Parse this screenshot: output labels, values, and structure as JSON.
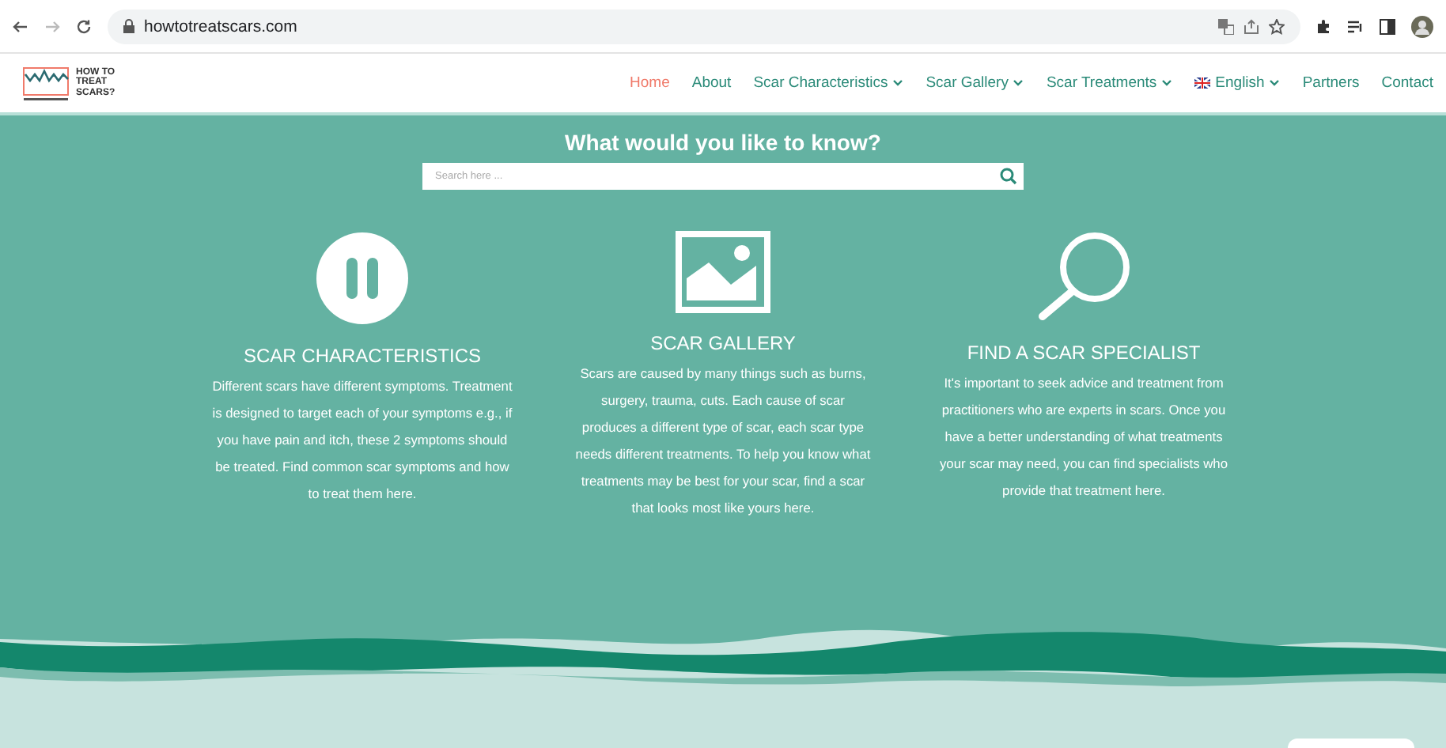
{
  "browser": {
    "url": "howtotreatscars.com"
  },
  "logo": {
    "text": "HOW TO TREAT SCARS?"
  },
  "nav": [
    {
      "label": "Home",
      "selected": true,
      "dropdown": false,
      "flag": false
    },
    {
      "label": "About",
      "selected": false,
      "dropdown": false,
      "flag": false
    },
    {
      "label": "Scar Characteristics",
      "selected": false,
      "dropdown": true,
      "flag": false
    },
    {
      "label": "Scar Gallery",
      "selected": false,
      "dropdown": true,
      "flag": false
    },
    {
      "label": "Scar Treatments",
      "selected": false,
      "dropdown": true,
      "flag": false
    },
    {
      "label": "English",
      "selected": false,
      "dropdown": true,
      "flag": true
    },
    {
      "label": "Partners",
      "selected": false,
      "dropdown": false,
      "flag": false
    },
    {
      "label": "Contact",
      "selected": false,
      "dropdown": false,
      "flag": false
    }
  ],
  "hero": {
    "title": "What would you like to know?",
    "search": {
      "placeholder": "Search here ..."
    }
  },
  "features": [
    {
      "kind": "pause",
      "title": "SCAR CHARACTERISTICS",
      "text": "Different scars have different symptoms. Treatment is designed to target each of your symptoms e.g., if you have pain and itch, these 2 symptoms should be treated. Find common scar symptoms and how to treat them here."
    },
    {
      "kind": "image",
      "title": "SCAR GALLERY",
      "text": "Scars are caused by many things such as burns, surgery, trauma, cuts. Each cause of scar produces a different type of scar, each scar type needs different treatments. To help you know what treatments may be best for your scar, find a scar that looks most like yours here."
    },
    {
      "kind": "magnifier",
      "title": "FIND A SCAR SPECIALIST",
      "text": "It's important to seek advice and treatment from practitioners who are experts in scars. Once you have a better understanding of what treatments your scar may need, you can find specialists who provide that treatment here."
    }
  ]
}
